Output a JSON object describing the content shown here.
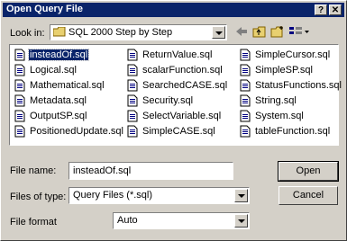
{
  "window": {
    "title": "Open Query File",
    "help_glyph": "?",
    "close_glyph": "✕"
  },
  "lookin": {
    "label": "Look in:",
    "value": "SQL 2000 Step by Step",
    "tools": [
      "back-icon",
      "up-folder-icon",
      "new-folder-icon",
      "views-menu-icon"
    ]
  },
  "files": [
    {
      "name": "insteadOf.sql",
      "selected": true
    },
    {
      "name": "Logical.sql"
    },
    {
      "name": "Mathematical.sql"
    },
    {
      "name": "Metadata.sql"
    },
    {
      "name": "OutputSP.sql"
    },
    {
      "name": "PositionedUpdate.sql"
    },
    {
      "name": "ReturnValue.sql"
    },
    {
      "name": "scalarFunction.sql"
    },
    {
      "name": "SearchedCASE.sql"
    },
    {
      "name": "Security.sql"
    },
    {
      "name": "SelectVariable.sql"
    },
    {
      "name": "SimpleCASE.sql"
    },
    {
      "name": "SimpleCursor.sql"
    },
    {
      "name": "SimpleSP.sql"
    },
    {
      "name": "StatusFunctions.sql"
    },
    {
      "name": "String.sql"
    },
    {
      "name": "System.sql"
    },
    {
      "name": "tableFunction.sql"
    }
  ],
  "filename": {
    "label": "File name:",
    "value": "insteadOf.sql"
  },
  "filetype": {
    "label": "Files of type:",
    "value": "Query Files (*.sql)"
  },
  "fileformat": {
    "label": "File format",
    "value": "Auto"
  },
  "buttons": {
    "open": "Open",
    "cancel": "Cancel"
  }
}
